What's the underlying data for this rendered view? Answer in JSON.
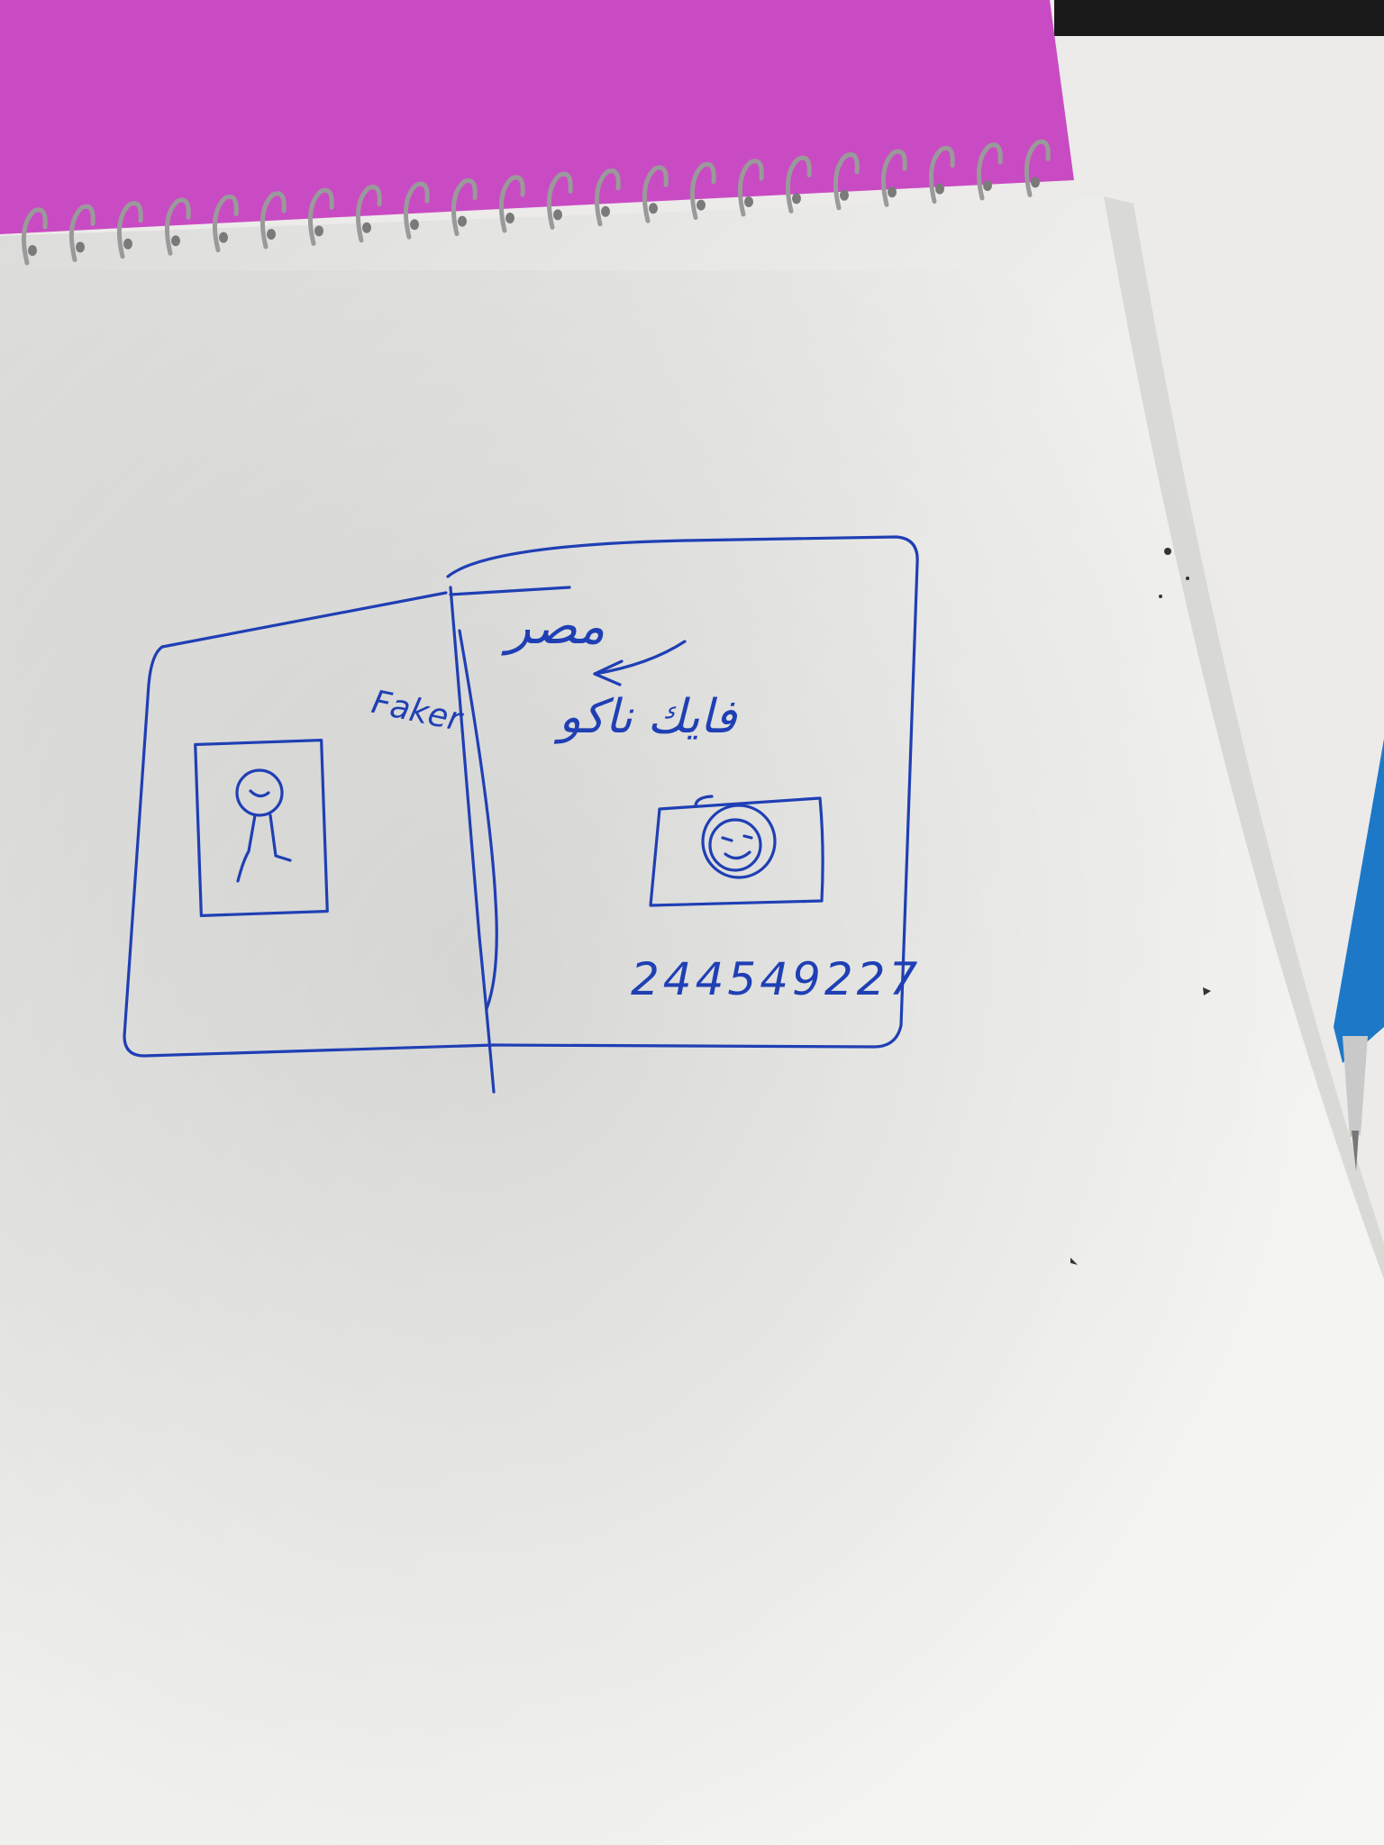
{
  "scene": {
    "subject": "hand-drawn ID card sketch on spiral notebook page",
    "notebook_cover_color": "#c94bc3",
    "paper_color": "#f1f1ef",
    "ink_color": "#1f3fb4",
    "pen_color": "#1e78c8"
  },
  "sketch": {
    "left_label": "Faker",
    "right_title": "فايك ناكو",
    "right_word": "مصر",
    "serial_number": "244549227"
  },
  "icons": {
    "portrait": "stick-figure-icon",
    "photo": "smiley-face-icon",
    "arrow": "arrow-icon"
  }
}
